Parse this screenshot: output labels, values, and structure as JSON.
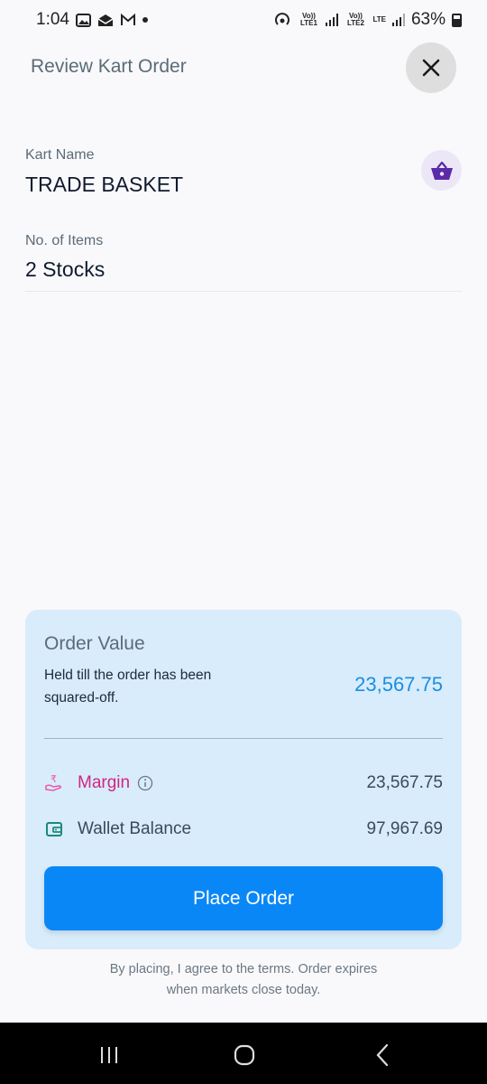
{
  "status_bar": {
    "time": "1:04",
    "battery": "63%",
    "network_labels": [
      "Vo)) LTE1",
      "Vo)) LTE2",
      "LTE"
    ]
  },
  "header": {
    "title": "Review Kart Order",
    "close_icon": "close-icon"
  },
  "kart": {
    "name_label": "Kart Name",
    "name_value": "TRADE BASKET",
    "items_label": "No. of Items",
    "items_value": "2 Stocks",
    "basket_icon": "basket-icon"
  },
  "order": {
    "title": "Order Value",
    "description": "Held till the order has been squared-off.",
    "value": "23,567.75",
    "margin_label": "Margin",
    "margin_value": "23,567.75",
    "wallet_label": "Wallet Balance",
    "wallet_value": "97,967.69",
    "place_button": "Place Order"
  },
  "terms": "By placing, I agree to the terms. Order expires when markets close today.",
  "colors": {
    "accent": "#0a87f7",
    "card_bg": "#d8ecfc",
    "order_value": "#1b8ee0",
    "margin": "#d0267f",
    "basket_icon": "#5b2aa8",
    "wallet_icon": "#1c8a79"
  }
}
